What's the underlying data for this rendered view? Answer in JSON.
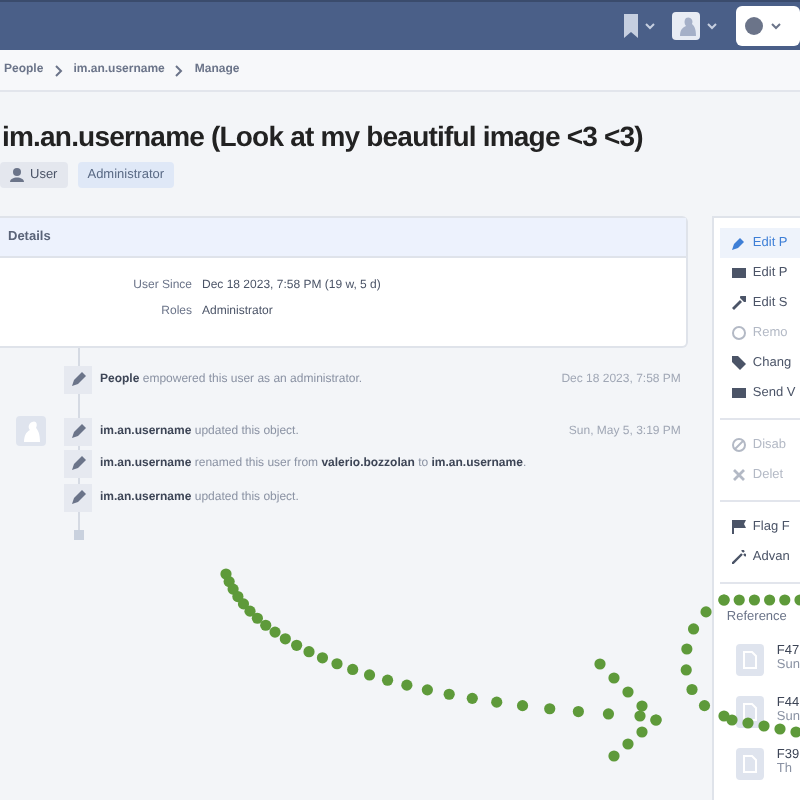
{
  "breadcrumbs": [
    "People",
    "im.an.username",
    "Manage"
  ],
  "title": "im.an.username (Look at my beautiful image <3 <3)",
  "tags": [
    {
      "label": "User",
      "kind": "icon"
    },
    {
      "label": "Administrator",
      "kind": "plain"
    }
  ],
  "details": {
    "header": "Details",
    "rows": [
      {
        "label": "User Since",
        "value": "Dec 18 2023, 7:58 PM (19 w, 5 d)"
      },
      {
        "label": "Roles",
        "value": "Administrator"
      }
    ]
  },
  "timeline": [
    {
      "text": "**People** empowered this user as an administrator.",
      "date": "Dec 18 2023, 7:58 PM",
      "avatar": false
    },
    {
      "text": "**im.an.username** updated this object.",
      "date": "Sun, May 5, 3:19 PM",
      "avatar": true
    },
    {
      "text": "**im.an.username** renamed this user from **valerio.bozzolan** to **im.an.username**.",
      "avatar": false
    },
    {
      "text": "**im.an.username** updated this object.",
      "avatar": false
    }
  ],
  "actions": [
    [
      {
        "label": "Edit P",
        "selected": true,
        "disabled": false
      },
      {
        "label": "Edit P",
        "selected": false,
        "disabled": false
      },
      {
        "label": "Edit S",
        "selected": false,
        "disabled": false
      },
      {
        "label": "Remo",
        "selected": false,
        "disabled": true
      },
      {
        "label": "Chang",
        "selected": false,
        "disabled": false
      },
      {
        "label": "Send V",
        "selected": false,
        "disabled": false
      }
    ],
    [
      {
        "label": "Disab",
        "selected": false,
        "disabled": true
      },
      {
        "label": "Delet",
        "selected": false,
        "disabled": true
      }
    ],
    [
      {
        "label": "Flag F",
        "selected": false,
        "disabled": false
      },
      {
        "label": "Advan",
        "selected": false,
        "disabled": false
      }
    ]
  ],
  "references": {
    "header": "Reference",
    "files": [
      {
        "name": "F47",
        "sub": "Sun"
      },
      {
        "name": "F44",
        "sub": "Sun"
      },
      {
        "name": "F39",
        "sub": "Th"
      }
    ]
  }
}
